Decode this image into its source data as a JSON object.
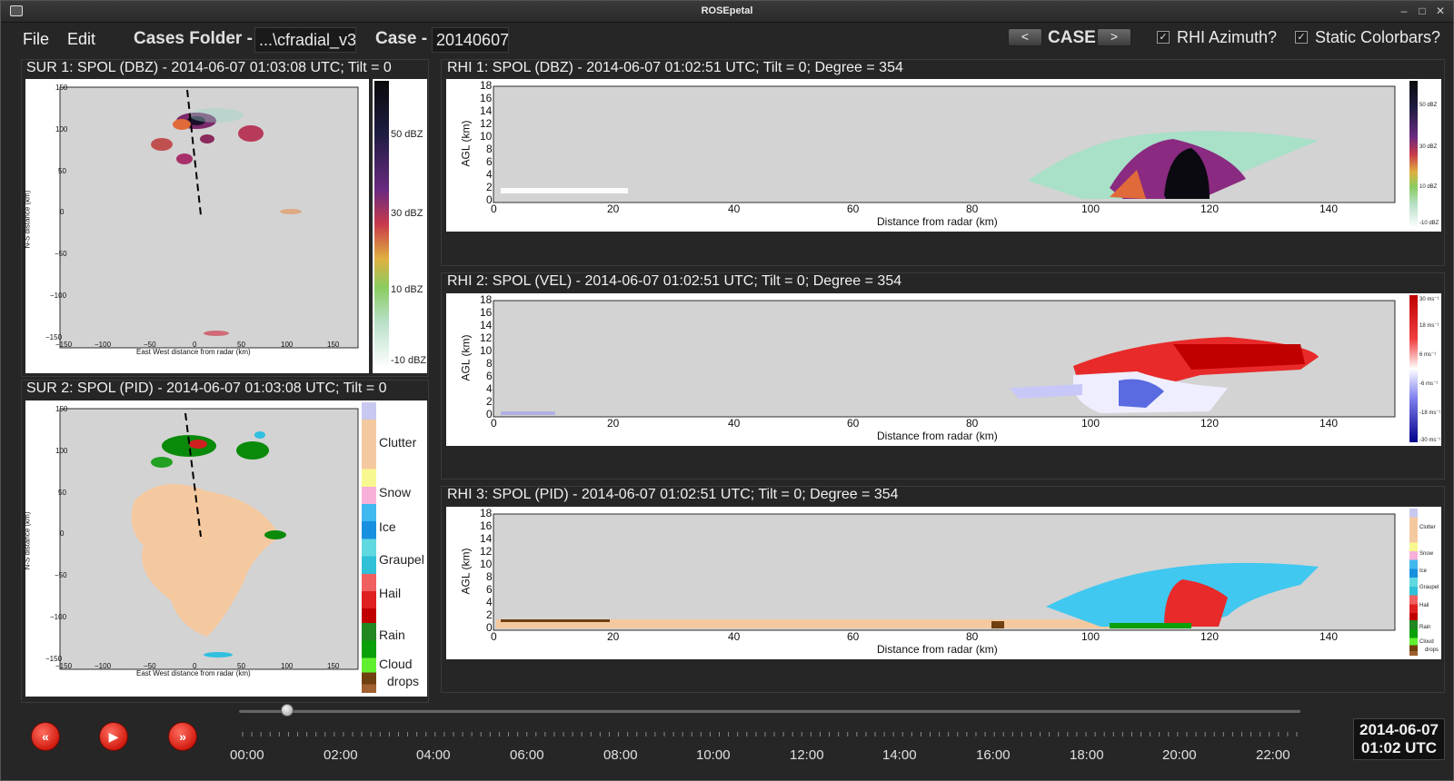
{
  "window": {
    "title": "ROSEpetal"
  },
  "menu": {
    "file": "File",
    "edit": "Edit"
  },
  "toolbar": {
    "cases_folder_label": "Cases Folder -",
    "cases_folder_value": "...\\cfradial_v3",
    "case_label": "Case -",
    "case_value": "20140607",
    "prev_label": "<",
    "case_nav_label": "CASE",
    "next_label": ">",
    "rhi_azimuth_label": "RHI Azimuth?",
    "rhi_azimuth_checked": true,
    "static_colorbars_label": "Static Colorbars?",
    "static_colorbars_checked": true
  },
  "sur1": {
    "title": "SUR 1: SPOL (DBZ) - 2014-06-07 01:03:08 UTC; Tilt = 0",
    "xlabel": "East West distance from radar (km)",
    "ylabel": "N-S distance (km)",
    "xticks": [
      "−150",
      "−100",
      "−50",
      "0",
      "50",
      "100",
      "150"
    ],
    "yticks": [
      "150",
      "100",
      "50",
      "0",
      "−50",
      "−100",
      "−150"
    ],
    "colorbar_ticks": [
      "50 dBZ",
      "30 dBZ",
      "10 dBZ",
      "-10 dBZ"
    ]
  },
  "sur2": {
    "title": "SUR 2: SPOL (PID) - 2014-06-07 01:03:08 UTC; Tilt = 0",
    "xlabel": "East West distance from radar (km)",
    "ylabel": "N-S distance (km)",
    "xticks": [
      "−150",
      "−100",
      "−50",
      "0",
      "50",
      "100",
      "150"
    ],
    "yticks": [
      "150",
      "100",
      "50",
      "0",
      "−50",
      "−100",
      "−150"
    ],
    "colorbar_labels": [
      "Clutter",
      "Snow",
      "Ice",
      "Graupel",
      "Hail",
      "Rain",
      "Cloud",
      "drops"
    ]
  },
  "rhi1": {
    "title": "RHI 1: SPOL (DBZ) - 2014-06-07 01:02:51 UTC; Tilt = 0; Degree = 354",
    "xlabel": "Distance from radar (km)",
    "ylabel": "AGL (km)",
    "xticks": [
      "0",
      "20",
      "40",
      "60",
      "80",
      "100",
      "120",
      "140"
    ],
    "yticks": [
      "18",
      "16",
      "14",
      "12",
      "10",
      "8",
      "6",
      "4",
      "2",
      "0"
    ],
    "colorbar_ticks": [
      "50 dBZ",
      "30 dBZ",
      "10 dBZ",
      "-10 dBZ"
    ]
  },
  "rhi2": {
    "title": "RHI 2: SPOL (VEL) - 2014-06-07 01:02:51 UTC; Tilt = 0; Degree = 354",
    "xlabel": "Distance from radar (km)",
    "ylabel": "AGL (km)",
    "xticks": [
      "0",
      "20",
      "40",
      "60",
      "80",
      "100",
      "120",
      "140"
    ],
    "yticks": [
      "18",
      "16",
      "14",
      "12",
      "10",
      "8",
      "6",
      "4",
      "2",
      "0"
    ],
    "colorbar_ticks": [
      "30 ms⁻¹",
      "18 ms⁻¹",
      "6 ms⁻¹",
      "-6 ms⁻¹",
      "-18 ms⁻¹",
      "-30 ms⁻¹"
    ]
  },
  "rhi3": {
    "title": "RHI 3: SPOL (PID) - 2014-06-07 01:02:51 UTC; Tilt = 0; Degree = 354",
    "xlabel": "Distance from radar (km)",
    "ylabel": "AGL (km)",
    "xticks": [
      "0",
      "20",
      "40",
      "60",
      "80",
      "100",
      "120",
      "140"
    ],
    "yticks": [
      "18",
      "16",
      "14",
      "12",
      "10",
      "8",
      "6",
      "4",
      "2",
      "0"
    ],
    "colorbar_labels": [
      "Clutter",
      "Snow",
      "Ice",
      "Graupel",
      "Hail",
      "Rain",
      "Cloud",
      "drops"
    ]
  },
  "playback": {
    "rewind_icon": "rewind-icon",
    "play_icon": "play-icon",
    "forward_icon": "fast-forward-icon",
    "time_labels": [
      "00:00",
      "02:00",
      "04:00",
      "06:00",
      "08:00",
      "10:00",
      "12:00",
      "14:00",
      "16:00",
      "18:00",
      "20:00",
      "22:00"
    ],
    "slider_fraction": 0.045,
    "current_date": "2014-06-07",
    "current_time": "01:02 UTC"
  }
}
